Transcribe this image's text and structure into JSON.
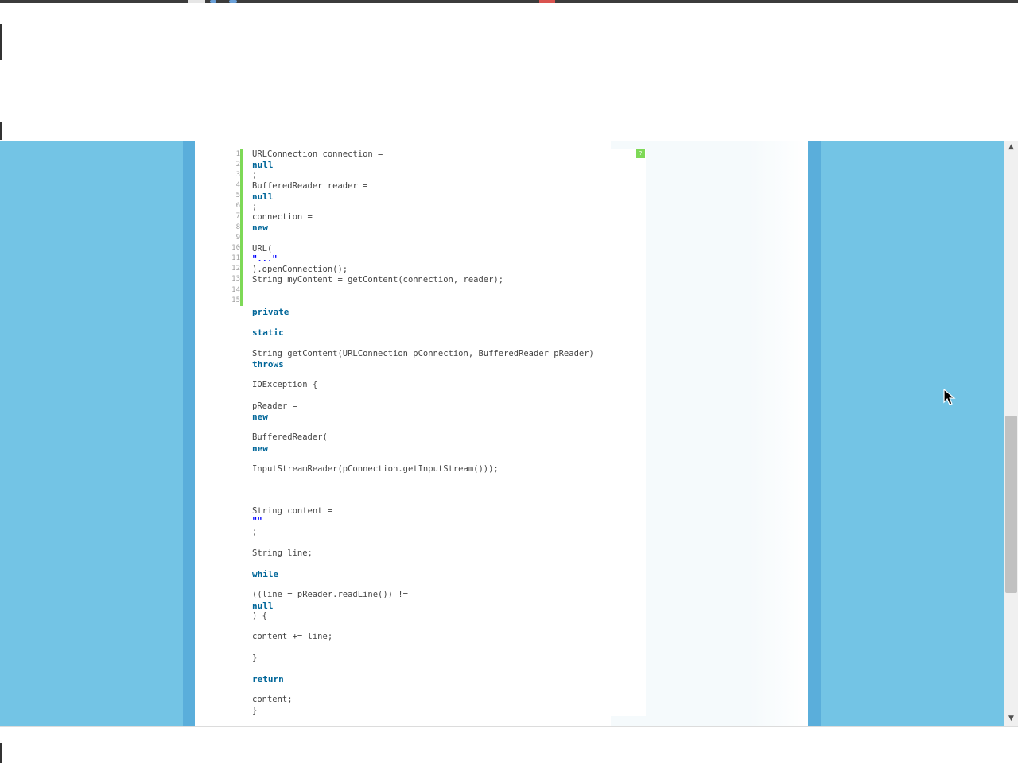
{
  "code_lines": [
    {
      "n": "1",
      "text": "URLConnection connection ="
    },
    {
      "n": "2",
      "text": "null"
    },
    {
      "n": "3",
      "text": ";"
    },
    {
      "n": "4",
      "text": "BufferedReader reader ="
    },
    {
      "n": "5",
      "text": "null"
    },
    {
      "n": "6",
      "text": ";"
    },
    {
      "n": "7",
      "text": "connection ="
    },
    {
      "n": "8",
      "text": "new"
    },
    {
      "n": "9",
      "text": ""
    },
    {
      "n": "10",
      "text": "URL("
    },
    {
      "n": "11",
      "text": "\"...\""
    },
    {
      "n": "12",
      "text": ").openConnection();"
    },
    {
      "n": "13",
      "text": "String myContent = getContent(connection, reader);"
    },
    {
      "n": "14",
      "text": ""
    },
    {
      "n": "15",
      "text": ""
    }
  ],
  "code_continuation": [
    "private",
    "static",
    "String getContent(URLConnection pConnection, BufferedReader pReader)",
    "throws",
    "IOException {",
    "pReader =",
    "new",
    "BufferedReader(",
    "new",
    "InputStreamReader(pConnection.getInputStream()));",
    "String content =",
    "\"\"",
    ";",
    "String line;",
    "while",
    "((line = pReader.readLine()) !=",
    "null",
    ") {",
    "content += line;",
    "}",
    "return",
    "content;",
    "}"
  ],
  "help_badge": "?",
  "scrollbar": {
    "up_arrow": "▲",
    "down_arrow": "▼"
  },
  "colors": {
    "page_background": "#73c4e5",
    "keyword": "#006699",
    "string": "#0000ff",
    "gutter_marker": "#7ed957"
  }
}
